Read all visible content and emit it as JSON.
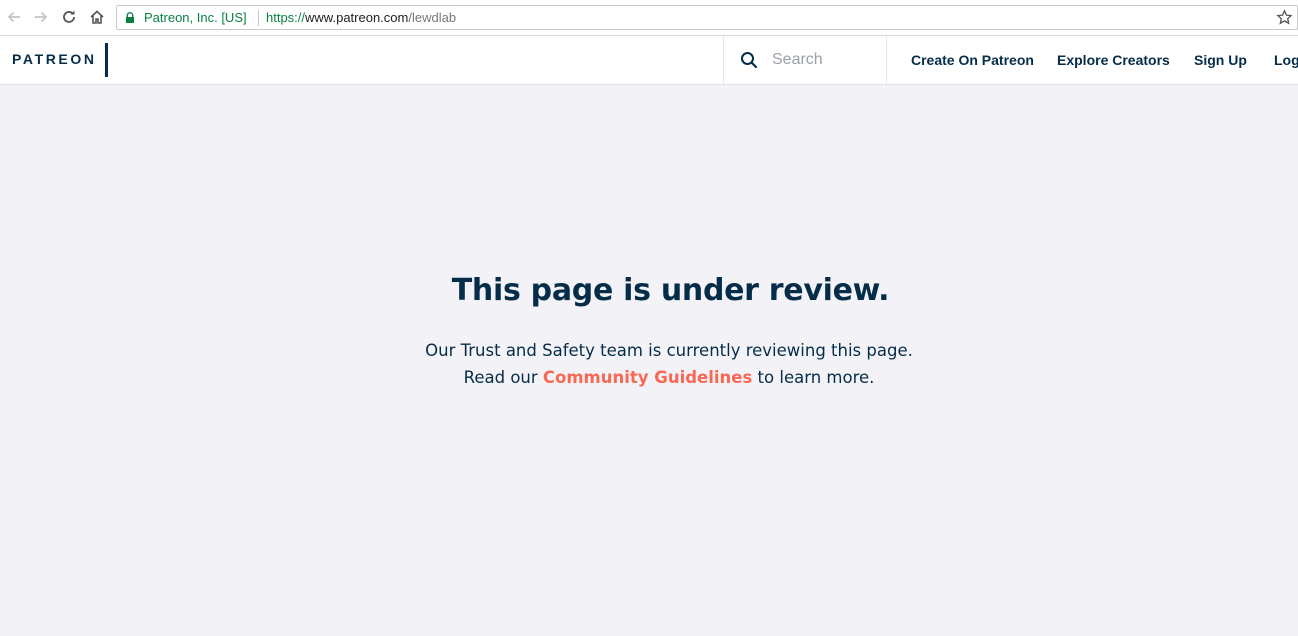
{
  "browser": {
    "site_identity": "Patreon, Inc. [US]",
    "url_scheme": "https://",
    "url_host": "www.patreon.com",
    "url_path": "/lewdlab",
    "icons": [
      "back-arrow-icon",
      "forward-arrow-icon",
      "reload-icon",
      "home-icon",
      "lock-icon",
      "bookmark-star-icon"
    ]
  },
  "header": {
    "logo": "PATREON",
    "search_placeholder": "Search",
    "nav": {
      "create": "Create On Patreon",
      "explore": "Explore Creators",
      "signup": "Sign Up",
      "login": "Log In"
    }
  },
  "main": {
    "title": "This page is under review.",
    "line1": "Our Trust and Safety team is currently reviewing this page.",
    "line2_prefix": "Read our",
    "link": "Community Guidelines",
    "line2_suffix": "to learn more."
  },
  "colors": {
    "brand_navy": "#052d49",
    "accent_coral": "#f96854",
    "page_bg": "#f3f3f7",
    "secure_green": "#0b8043"
  }
}
